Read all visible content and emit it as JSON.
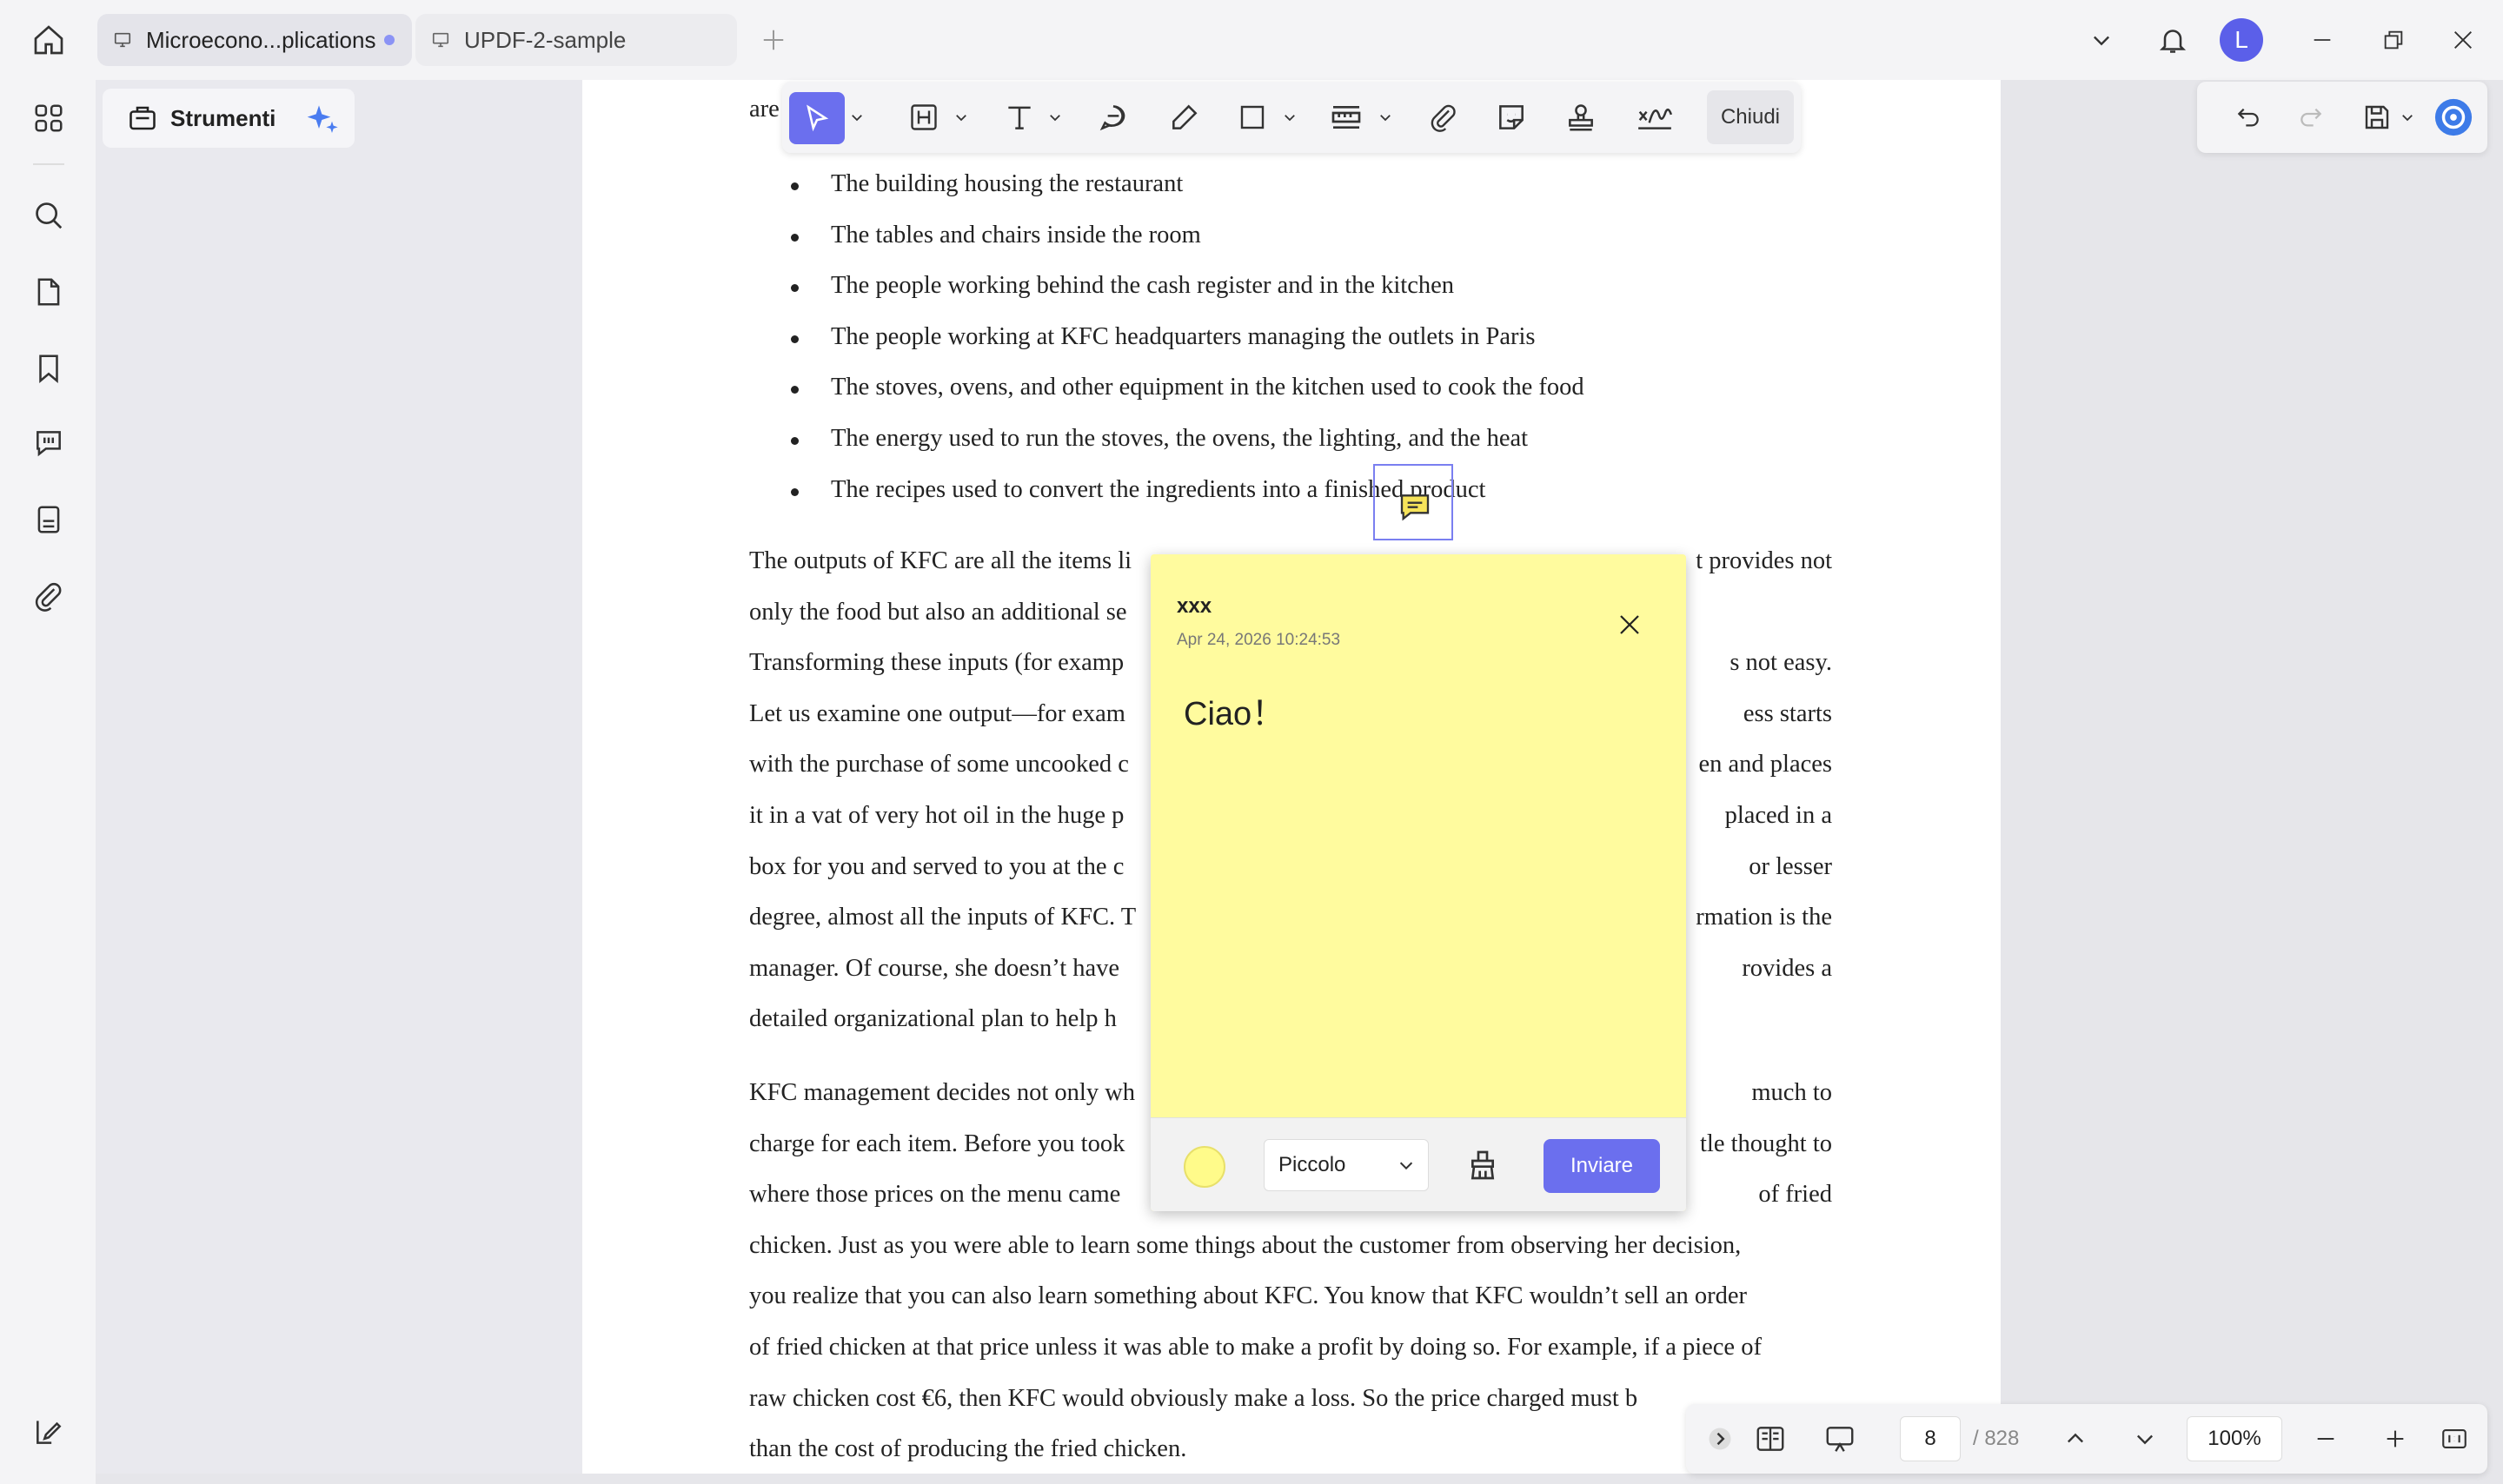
{
  "tabs": [
    {
      "label": "Microecono...plications",
      "active": true
    },
    {
      "label": "UPDF-2-sample",
      "active": false
    }
  ],
  "user": {
    "initial": "L"
  },
  "sidepanel": {
    "title": "Strumenti"
  },
  "toolbar": {
    "close_label": "Chiudi"
  },
  "document": {
    "fragment_top": "are",
    "bullets": [
      "The building housing the restaurant",
      "The tables and chairs inside the room",
      "The people working behind the cash register and in the kitchen",
      "The people working at KFC headquarters managing the outlets in Paris",
      "The stoves, ovens, and other equipment in the kitchen used to cook the food",
      "The energy used to run the stoves, the ovens, the lighting, and the heat",
      "The recipes used to convert the ingredients into a finished product"
    ],
    "para1": [
      {
        "left": "The outputs of KFC are all the items li",
        "right": "t provides not"
      },
      {
        "left": "only the food but also an additional se",
        "right": ""
      },
      {
        "left": "Transforming these inputs (for examp",
        "right": "s not easy."
      },
      {
        "left": "Let us examine one output—for exam",
        "right": "ess starts"
      },
      {
        "left": "with the purchase of some uncooked c",
        "right": "en and places"
      },
      {
        "left": "it in a vat of very hot oil in the huge p",
        "right": "placed in a"
      },
      {
        "left": "box for you and served to you at the c",
        "right": "or lesser"
      },
      {
        "left": "degree, almost all the inputs of KFC. T",
        "right": "rmation is the"
      },
      {
        "left": "manager. Of course, she doesn’t have",
        "right": "rovides a"
      },
      {
        "left": "detailed organizational plan to help h",
        "right": ""
      }
    ],
    "para2": [
      {
        "left": "KFC management decides not only wh",
        "right": "much to"
      },
      {
        "left": "charge for each item. Before you took",
        "right": "tle thought to"
      },
      {
        "left": "where those prices on the menu came",
        "right": "of fried"
      },
      {
        "left": "chicken. Just as you were able to learn some things about the customer from observing her decision,",
        "right": ""
      },
      {
        "left": "you realize that you can also learn something about KFC. You know that KFC wouldn’t sell an order",
        "right": ""
      },
      {
        "left": "of fried chicken at that price unless it was able to make a profit by doing so. For example, if a piece of",
        "right": ""
      },
      {
        "left": "raw chicken cost €6, then KFC would obviously make a loss. So the price charged must b",
        "right": ""
      },
      {
        "left": "than the cost of producing the fried chicken.",
        "right": ""
      }
    ]
  },
  "note": {
    "author": "xxx",
    "date": "Apr 24, 2026 10:24:53",
    "content": "Ciao！",
    "color": "#fffb9e",
    "size_value": "Piccolo",
    "send_label": "Inviare"
  },
  "pager": {
    "current": "8",
    "total": "/ 828",
    "zoom": "100%"
  },
  "colors": {
    "accent": "#6b6fee",
    "note_bg": "#fffb9e"
  }
}
